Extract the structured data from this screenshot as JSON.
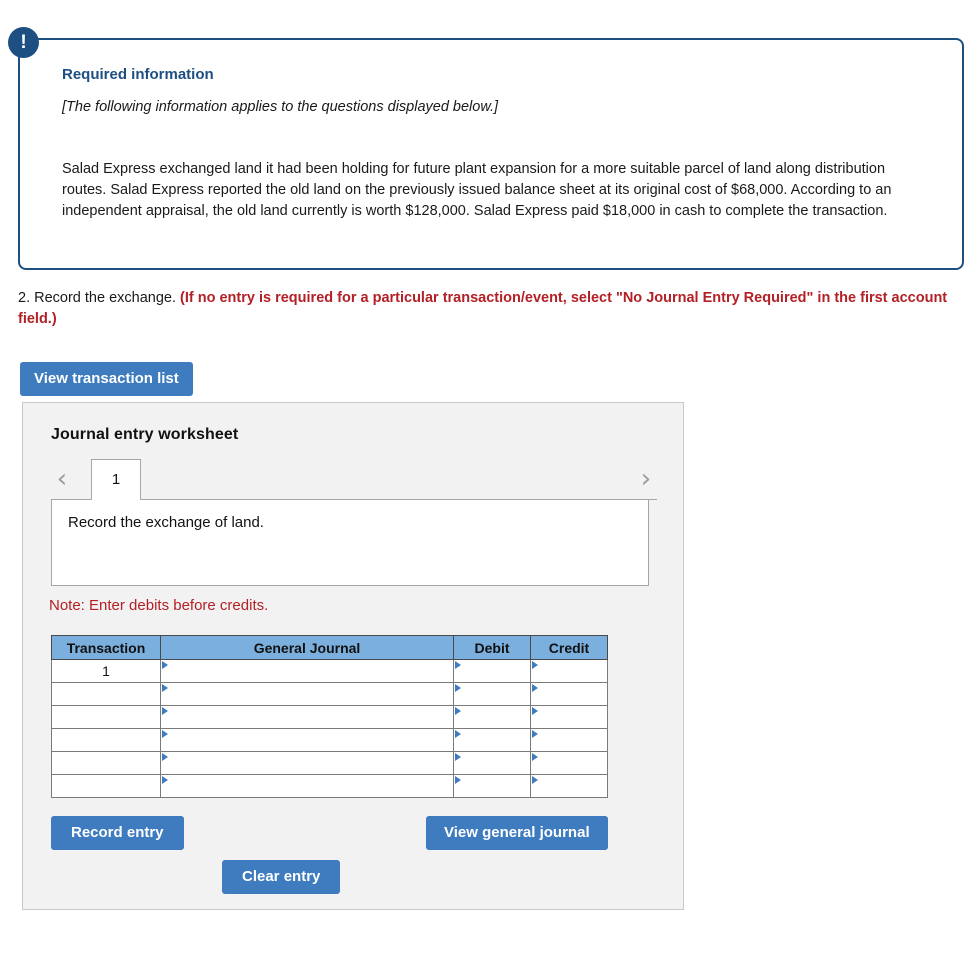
{
  "required_info": {
    "badge_icon": "exclamation-icon",
    "badge_glyph": "!",
    "title": "Required information",
    "subtitle": "[The following information applies to the questions displayed below.]",
    "body": "Salad Express exchanged land it had been holding for future plant expansion for a more suitable parcel of land along distribution routes. Salad Express reported the old land on the previously issued balance sheet at its original cost of $68,000. According to an independent appraisal, the old land currently is worth $128,000. Salad Express paid $18,000 in cash to complete the transaction.",
    "border_color": "#1d4f82",
    "title_color": "#1d4f82"
  },
  "question": {
    "number_and_text": "2. Record the exchange. ",
    "instruction_red": "(If no entry is required for a particular transaction/event, select \"No Journal Entry Required\" in the first account field.)",
    "red_color": "#b32025"
  },
  "buttons": {
    "view_transaction_list": "View transaction list",
    "record_entry": "Record entry",
    "clear_entry": "Clear entry",
    "view_general_journal": "View general journal",
    "primary_color": "#3e7bbf"
  },
  "worksheet": {
    "title": "Journal entry worksheet",
    "prev_icon": "chevron-left-icon",
    "next_icon": "chevron-right-icon",
    "prev_glyph": "‹",
    "next_glyph": "›",
    "tabs": [
      {
        "label": "1",
        "active": true
      }
    ],
    "prompt": "Record the exchange of land.",
    "note": "Note: Enter debits before credits.",
    "note_color": "#b32025"
  },
  "journal_table": {
    "header_color": "#7bafdd",
    "columns": [
      "Transaction",
      "General Journal",
      "Debit",
      "Credit"
    ],
    "rows": [
      {
        "transaction": "1",
        "general_journal": "",
        "debit": "",
        "credit": ""
      },
      {
        "transaction": "",
        "general_journal": "",
        "debit": "",
        "credit": ""
      },
      {
        "transaction": "",
        "general_journal": "",
        "debit": "",
        "credit": ""
      },
      {
        "transaction": "",
        "general_journal": "",
        "debit": "",
        "credit": ""
      },
      {
        "transaction": "",
        "general_journal": "",
        "debit": "",
        "credit": ""
      },
      {
        "transaction": "",
        "general_journal": "",
        "debit": "",
        "credit": ""
      }
    ]
  }
}
